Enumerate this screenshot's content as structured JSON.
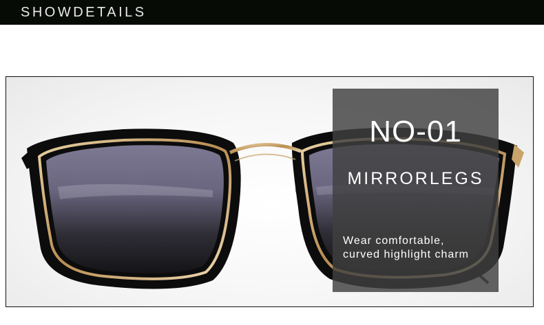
{
  "header": {
    "title": "SHOWDETAILS"
  },
  "product": {
    "model": "NO-01",
    "feature": "MIRRORLEGS",
    "description_line1": "Wear comfortable,",
    "description_line2": "curved highlight charm"
  },
  "colors": {
    "header_bg": "#060b06",
    "overlay_bg": "rgba(64,64,64,0.82)",
    "frame_black": "#0d0d0d",
    "gold_trim": "#c9a36a"
  }
}
